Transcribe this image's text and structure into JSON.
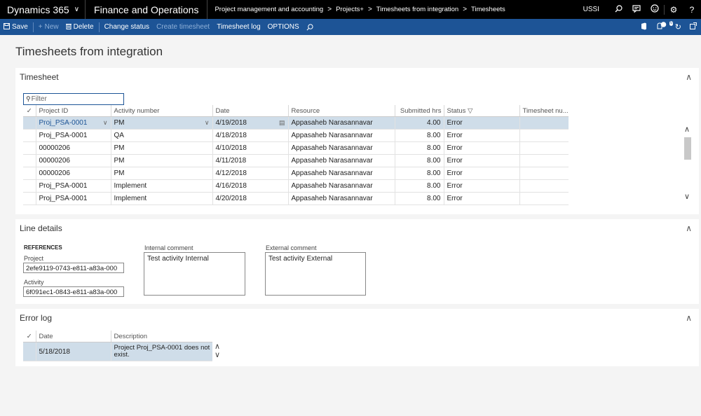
{
  "nav": {
    "app_name": "Dynamics 365",
    "module_name": "Finance and Operations",
    "breadcrumb": [
      "Project management and accounting",
      "Projects+",
      "Timesheets from integration",
      "Timesheets"
    ],
    "company": "USSI"
  },
  "actions": {
    "save": "Save",
    "new": "New",
    "delete": "Delete",
    "change_status": "Change status",
    "create_timesheet": "Create timesheet",
    "timesheet_log": "Timesheet log",
    "options": "OPTIONS",
    "notification_count": "0"
  },
  "page_title": "Timesheets from integration",
  "timesheet": {
    "header": "Timesheet",
    "filter_placeholder": "Filter",
    "columns": [
      "Project ID",
      "Activity number",
      "Date",
      "Resource",
      "Submitted hrs",
      "Status",
      "Timesheet nu..."
    ],
    "rows": [
      {
        "project_id": "Proj_PSA-0001",
        "activity": "PM",
        "date": "4/19/2018",
        "resource": "Appasaheb Narasannavar",
        "hours": "4.00",
        "status": "Error",
        "timesheet_no": ""
      },
      {
        "project_id": "Proj_PSA-0001",
        "activity": "QA",
        "date": "4/18/2018",
        "resource": "Appasaheb Narasannavar",
        "hours": "8.00",
        "status": "Error",
        "timesheet_no": ""
      },
      {
        "project_id": "00000206",
        "activity": "PM",
        "date": "4/10/2018",
        "resource": "Appasaheb Narasannavar",
        "hours": "8.00",
        "status": "Error",
        "timesheet_no": ""
      },
      {
        "project_id": "00000206",
        "activity": "PM",
        "date": "4/11/2018",
        "resource": "Appasaheb Narasannavar",
        "hours": "8.00",
        "status": "Error",
        "timesheet_no": ""
      },
      {
        "project_id": "00000206",
        "activity": "PM",
        "date": "4/12/2018",
        "resource": "Appasaheb Narasannavar",
        "hours": "8.00",
        "status": "Error",
        "timesheet_no": ""
      },
      {
        "project_id": "Proj_PSA-0001",
        "activity": "Implement",
        "date": "4/16/2018",
        "resource": "Appasaheb Narasannavar",
        "hours": "8.00",
        "status": "Error",
        "timesheet_no": ""
      },
      {
        "project_id": "Proj_PSA-0001",
        "activity": "Implement",
        "date": "4/20/2018",
        "resource": "Appasaheb Narasannavar",
        "hours": "8.00",
        "status": "Error",
        "timesheet_no": ""
      }
    ]
  },
  "line_details": {
    "header": "Line details",
    "references_label": "REFERENCES",
    "project_label": "Project",
    "project_value": "2efe9119-0743-e811-a83a-000",
    "activity_label": "Activity",
    "activity_value": "6f091ec1-0843-e811-a83a-000",
    "internal_comment_label": "Internal comment",
    "internal_comment_value": "Test activity Internal",
    "external_comment_label": "External comment",
    "external_comment_value": "Test activity External"
  },
  "error_log": {
    "header": "Error log",
    "columns": [
      "Date",
      "Description"
    ],
    "rows": [
      {
        "date": "5/18/2018",
        "description": "Project Proj_PSA-0001 does not exist."
      }
    ]
  }
}
